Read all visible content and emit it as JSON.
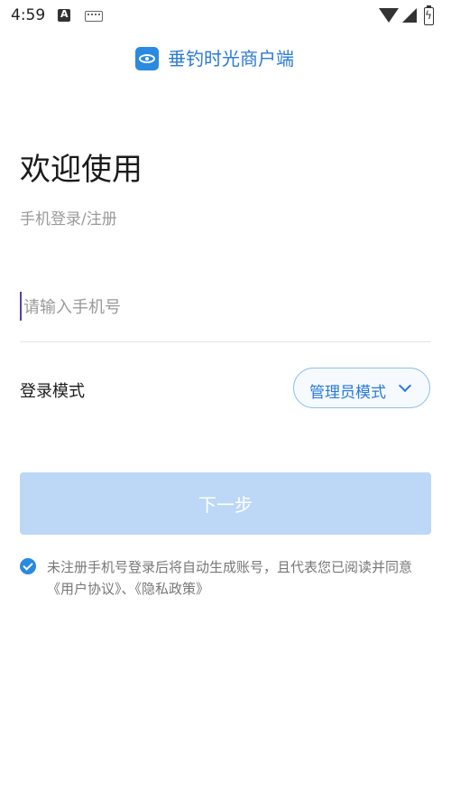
{
  "status": {
    "time": "4:59"
  },
  "brand": {
    "name": "垂钓时光商户端",
    "logo_icon": "fishing-eye-logo",
    "color": "#2a7ad6"
  },
  "login": {
    "title": "欢迎使用",
    "subtitle": "手机登录/注册",
    "phone_placeholder": "请输入手机号",
    "phone_value": "",
    "mode_label": "登录模式",
    "mode_value": "管理员模式",
    "next_label": "下一步",
    "next_color": "#bcd8f6"
  },
  "agreement": {
    "checked": true,
    "text": "未注册手机号登录后将自动生成账号，且代表您已阅读并同意",
    "user_link": "《用户协议》",
    "separator": "、",
    "privacy_link": "《隐私政策》"
  }
}
